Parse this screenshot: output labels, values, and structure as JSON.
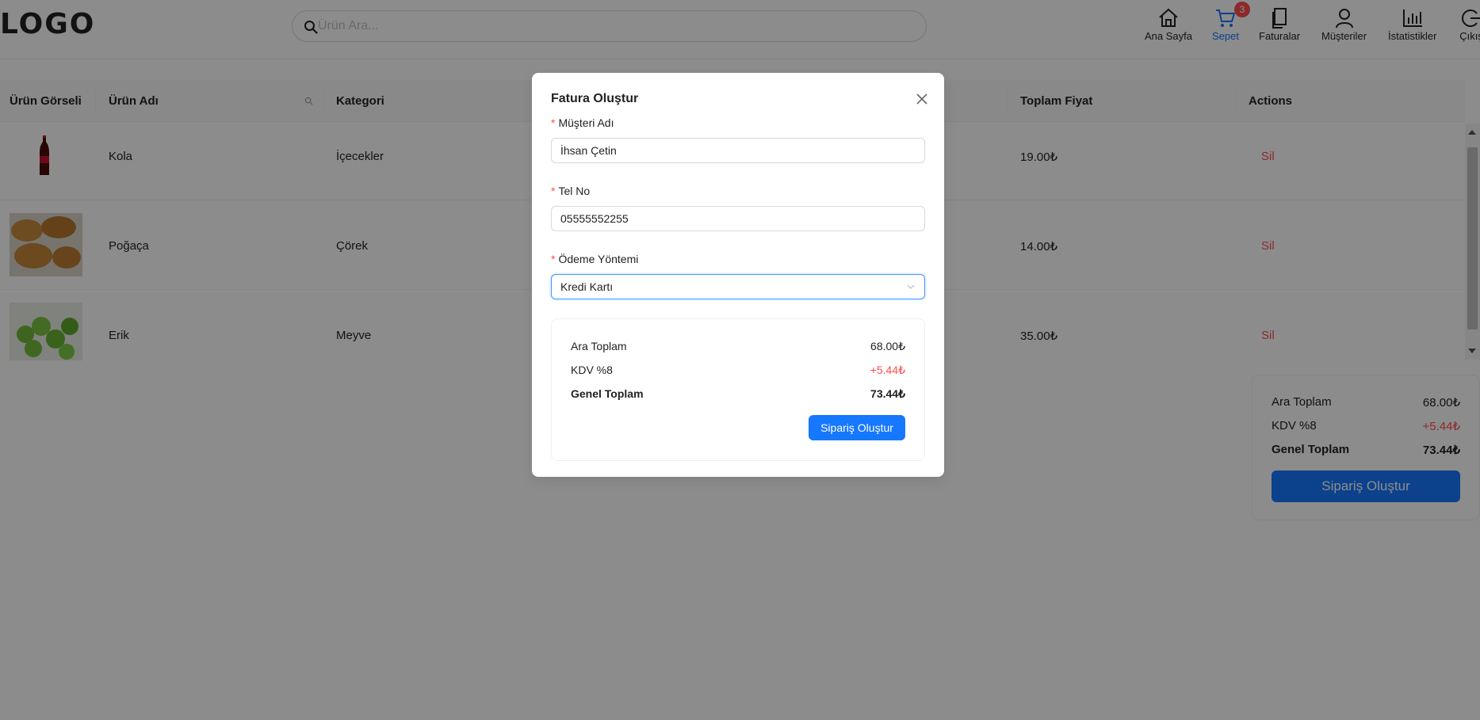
{
  "header": {
    "logo": "LOGO",
    "search_placeholder": "Ürün Ara...",
    "nav": [
      {
        "label": "Ana Sayfa"
      },
      {
        "label": "Sepet",
        "badge": "3",
        "active": true
      },
      {
        "label": "Faturalar"
      },
      {
        "label": "Müşteriler"
      },
      {
        "label": "İstatistikler"
      },
      {
        "label": "Çıkış"
      }
    ]
  },
  "table": {
    "columns": [
      "Ürün Görseli",
      "Ürün Adı",
      "Kategori",
      "Toplam Fiyat",
      "Actions"
    ],
    "rows": [
      {
        "name": "Kola",
        "category": "İçecekler",
        "total": "19.00₺",
        "action": "Sil"
      },
      {
        "name": "Poğaça",
        "category": "Çörek",
        "total": "14.00₺",
        "action": "Sil"
      },
      {
        "name": "Erik",
        "category": "Meyve",
        "total": "35.00₺",
        "action": "Sil"
      }
    ]
  },
  "summary": {
    "subtotal_label": "Ara Toplam",
    "subtotal_value": "68.00₺",
    "tax_label": "KDV %8",
    "tax_value": "+5.44₺",
    "total_label": "Genel Toplam",
    "total_value": "73.44₺",
    "button": "Sipariş Oluştur"
  },
  "modal": {
    "title": "Fatura Oluştur",
    "required_mark": "*",
    "customer_label": "Müşteri Adı",
    "customer_value": "İhsan Çetin",
    "phone_label": "Tel No",
    "phone_value": "05555552255",
    "payment_label": "Ödeme Yöntemi",
    "payment_value": "Kredi Kartı",
    "subtotal_label": "Ara Toplam",
    "subtotal_value": "68.00₺",
    "tax_label": "KDV %8",
    "tax_value": "+5.44₺",
    "total_label": "Genel Toplam",
    "total_value": "73.44₺",
    "button": "Sipariş Oluştur"
  },
  "colors": {
    "primary": "#1677ff",
    "danger": "#ff4d4f"
  }
}
